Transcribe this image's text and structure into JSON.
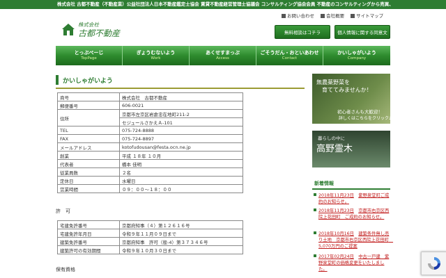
{
  "topbar": {
    "text": "株式会社 古都不動産（不動産業）公益社団法人日本不動産鑑定士協会 賃貸不動産経営管理士協議会 コンサルティング協会会員 不動産のコンサルティングから売買、管理、なんでもお任せください。"
  },
  "logo": {
    "small": "株式会社",
    "big": "古都不動産"
  },
  "toplinks": [
    "お問い合わせ",
    "会社概要",
    "サイトマップ"
  ],
  "buttons": {
    "consult": "無料相談はコチラ",
    "privacy": "個人情報に関する同意文"
  },
  "nav": [
    {
      "jp": "とっぷぺーじ",
      "en": "TopPage"
    },
    {
      "jp": "ぎょうむないよう",
      "en": "Work"
    },
    {
      "jp": "あくせすまっぷ",
      "en": "Access"
    },
    {
      "jp": "ごそうだん・おといあわせ",
      "en": "Contact"
    },
    {
      "jp": "かいしゃがいよう",
      "en": "Company"
    }
  ],
  "page_title": "かいしゃがいよう",
  "company_table": {
    "shogo_k": "商号",
    "shogo_v": "株式会社　古都不動産",
    "zip_k": "郵便番号",
    "zip_v": "606-0021",
    "addr_k": "住所",
    "addr_v1": "京都市左京区岩倉忠在地町211-2",
    "addr_v2": "セジュールさかえＡ-101",
    "tel_k": "TEL",
    "tel_v": "075-724-8888",
    "fax_k": "FAX",
    "fax_v": "075-724-8897",
    "mail_k": "メールアドレス",
    "mail_v": "kotofudousan@festa.ocn.ne.jp",
    "founded_k": "創業",
    "founded_v": "平成 １８年 １０月",
    "rep_k": "代表者",
    "rep_v": "橋本 佳明",
    "emp_k": "従業員数",
    "emp_v": "２名",
    "holiday_k": "定休日",
    "holiday_v": "水曜日",
    "hours_k": "営業時間",
    "hours_v": "０９：００〜１８：００"
  },
  "license_label": "許　可",
  "license_table": {
    "l1_k": "宅建免許番号",
    "l1_v": "京都府知事（４）第１２６１６号",
    "l2_k": "宅建免許年月日",
    "l2_v": "令和９年１１月０９日まで",
    "l3_k": "建築免許番号",
    "l3_v": "京都府知事　許可（般-4）第３７３４６号",
    "l4_k": "建築許可の有効期間",
    "l4_v": "令和９年１０月３０日まで"
  },
  "qual_label": "保有資格",
  "banner1": {
    "line1": "無農薬野菜を",
    "line2": "育ててみませんか！",
    "line3": "初心者さんも大歓迎！",
    "line4": "詳しくはこちらをクリック♪"
  },
  "banner2": {
    "line1": "暮らしの中に",
    "line2": "高野霊木"
  },
  "news": {
    "heading": "新着情報",
    "items": [
      {
        "date": "2018年11月23日",
        "text": "紫野泉堂町ご成約のお知らせ。"
      },
      {
        "date": "2018年11月23日",
        "text": "京都市右京区西院上花田町　ご成約のお知らせ。"
      },
      {
        "date": "2018年10月16日",
        "text": "建築条件無し売り土地　京都市右京区西院上花田町　5,070万円のご提案"
      },
      {
        "date": "2017年02月24日",
        "text": "中古一戸建　紫野泉堂町の価格変更をいたしました。"
      }
    ]
  },
  "colors": {
    "brand_green": "#2e7d32",
    "news_red": "#c01818"
  }
}
